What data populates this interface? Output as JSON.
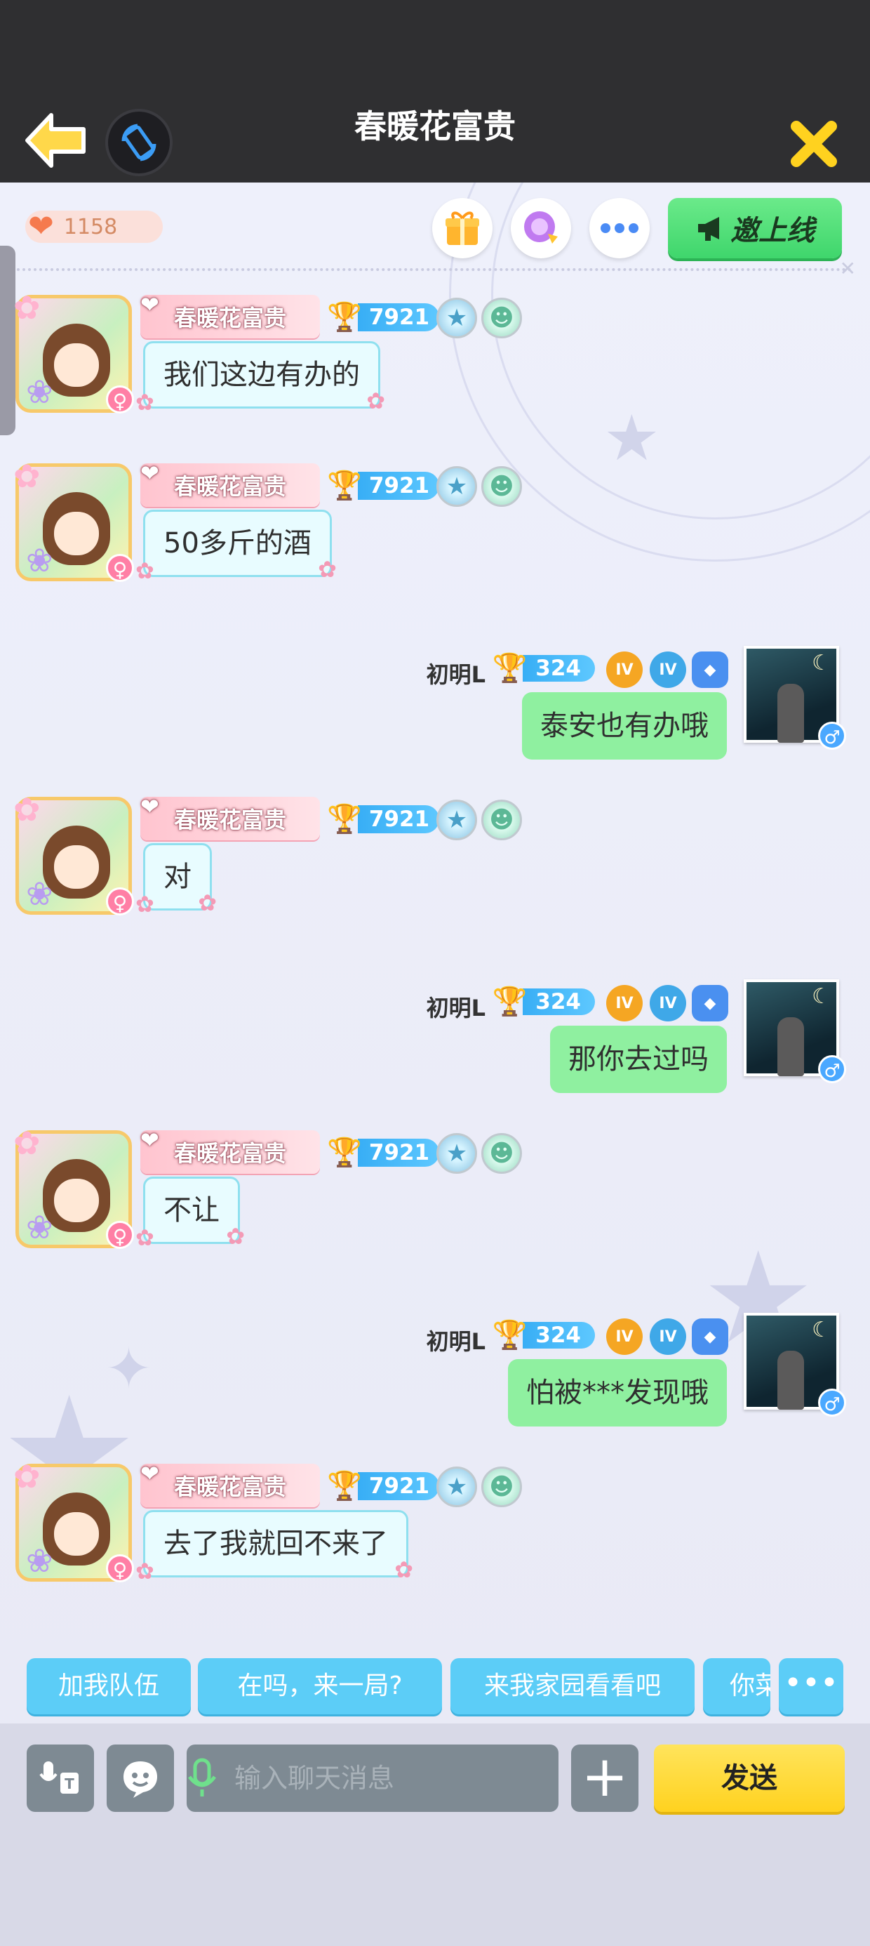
{
  "header": {
    "title": "春暖花富贵"
  },
  "status": {
    "hearts_count": "1158",
    "invite_label": "邀上线"
  },
  "messages": [
    {
      "side": "left",
      "name": "春暖花富贵",
      "level": "7921",
      "text": "我们这边有办的"
    },
    {
      "side": "left",
      "name": "春暖花富贵",
      "level": "7921",
      "text": "50多斤的酒"
    },
    {
      "side": "right",
      "name": "初明L",
      "level": "324",
      "text": "泰安也有办哦"
    },
    {
      "side": "left",
      "name": "春暖花富贵",
      "level": "7921",
      "text": "对"
    },
    {
      "side": "right",
      "name": "初明L",
      "level": "324",
      "text": "那你去过吗"
    },
    {
      "side": "left",
      "name": "春暖花富贵",
      "level": "7921",
      "text": "不让"
    },
    {
      "side": "right",
      "name": "初明L",
      "level": "324",
      "text": "怕被***发现哦"
    },
    {
      "side": "left",
      "name": "春暖花富贵",
      "level": "7921",
      "text": "去了我就回不来了"
    }
  ],
  "quick_replies": [
    "加我队伍",
    "在吗，来一局?",
    "来我家园看看吧",
    "你菜"
  ],
  "input": {
    "placeholder": "输入聊天消息",
    "value": ""
  },
  "send_label": "发送",
  "colors": {
    "header_bg": "#2f2f31",
    "accent_green": "#3fd66c",
    "quick_reply_blue": "#5ccdf7",
    "send_yellow": "#ffd21f"
  },
  "icons": {
    "back": "back-arrow-icon",
    "rotate": "rotate-screen-icon",
    "close": "close-icon",
    "gift": "gift-icon",
    "magic": "magic-orb-icon",
    "more": "more-icon",
    "megaphone": "megaphone-icon",
    "voice_text": "voice-to-text-icon",
    "emoji": "emoji-icon",
    "mic": "microphone-icon",
    "plus": "plus-icon"
  }
}
